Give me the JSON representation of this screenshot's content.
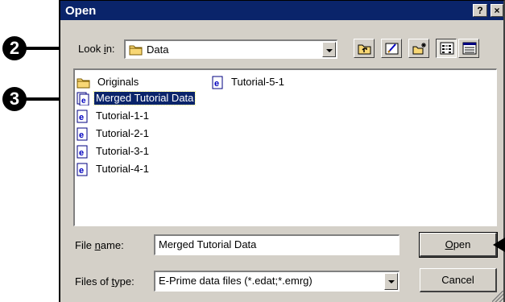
{
  "callouts": {
    "c2": "2",
    "c3": "3"
  },
  "titlebar": {
    "title": "Open",
    "help": "?",
    "close": "×"
  },
  "lookin": {
    "label_pre": "Look ",
    "label_u": "i",
    "label_post": "n:",
    "value": "Data"
  },
  "toolbar": {
    "icons": [
      "up-one-level-icon",
      "desktop-icon",
      "new-folder-icon",
      "list-view-icon",
      "details-view-icon"
    ]
  },
  "files": [
    {
      "name": "Originals",
      "type": "folder"
    },
    {
      "name": "Merged Tutorial Data",
      "type": "emrg",
      "selected": true
    },
    {
      "name": "Tutorial-1-1",
      "type": "edat"
    },
    {
      "name": "Tutorial-2-1",
      "type": "edat"
    },
    {
      "name": "Tutorial-3-1",
      "type": "edat"
    },
    {
      "name": "Tutorial-4-1",
      "type": "edat"
    },
    {
      "name": "Tutorial-5-1",
      "type": "edat"
    }
  ],
  "filename": {
    "label_pre": "File ",
    "label_u": "n",
    "label_post": "ame:",
    "value": "Merged Tutorial Data"
  },
  "filetype": {
    "label_pre": "Files of ",
    "label_u": "t",
    "label_post": "ype:",
    "value": "E-Prime data files (*.edat;*.emrg)"
  },
  "buttons": {
    "open_u": "O",
    "open_rest": "pen",
    "cancel": "Cancel"
  },
  "colors": {
    "titlebar": "#0a246a",
    "dialog_bg": "#d4d0c8",
    "selection": "#0a246a"
  }
}
